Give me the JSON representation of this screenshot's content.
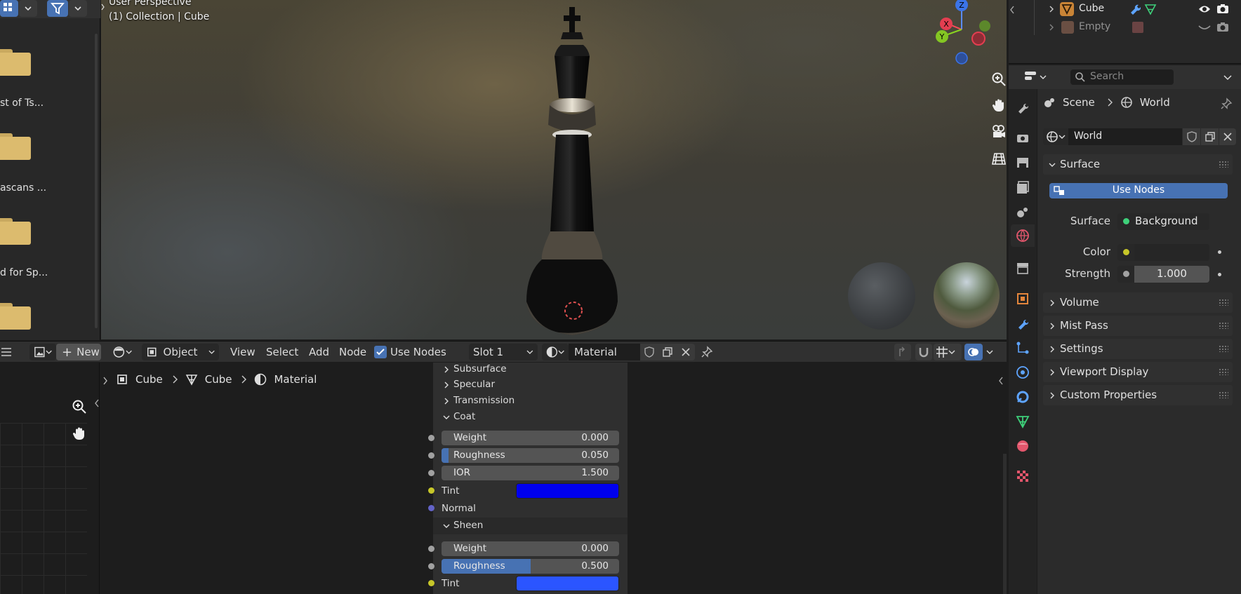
{
  "file_browser": {
    "items": [
      {
        "label": "st of Ts..."
      },
      {
        "label": "ascans ..."
      },
      {
        "label": "d for Sp..."
      },
      {
        "label": ""
      }
    ]
  },
  "viewport": {
    "line1": "User Perspective",
    "line2": "(1) Collection | Cube",
    "gizmo": {
      "z": "Z",
      "x": "X",
      "y": "Y"
    }
  },
  "node_editor_header": {
    "new_label": "New",
    "mode_label": "Object",
    "menus": [
      "View",
      "Select",
      "Add",
      "Node"
    ],
    "use_nodes_label": "Use Nodes",
    "use_nodes_checked": true,
    "slot_label": "Slot 1",
    "material_name": "Material"
  },
  "breadcrumb": [
    "Cube",
    "Cube",
    "Material"
  ],
  "node": {
    "collapsed": [
      "Subsurface",
      "Specular",
      "Transmission"
    ],
    "coat": {
      "title": "Coat",
      "weight": {
        "label": "Weight",
        "value": "0.000",
        "fraction": 0
      },
      "roughness": {
        "label": "Roughness",
        "value": "0.050",
        "fraction": 0.05
      },
      "ior": {
        "label": "IOR",
        "value": "1.500",
        "fraction": 0
      },
      "tint_label": "Tint",
      "tint_color": "#0000ee",
      "normal_label": "Normal"
    },
    "sheen": {
      "title": "Sheen",
      "weight": {
        "label": "Weight",
        "value": "0.000",
        "fraction": 0
      },
      "roughness": {
        "label": "Roughness",
        "value": "0.500",
        "fraction": 0.5
      },
      "tint_label": "Tint",
      "tint_color": "#2b55ff"
    }
  },
  "outliner": {
    "items": [
      {
        "label": "Cube"
      },
      {
        "label": "Empty"
      }
    ]
  },
  "properties": {
    "search_placeholder": "Search",
    "breadcrumb_scene": "Scene",
    "breadcrumb_world": "World",
    "world_name": "World",
    "surface_panel": "Surface",
    "use_nodes_button": "Use Nodes",
    "surface_label": "Surface",
    "surface_value": "Background",
    "color_label": "Color",
    "strength_label": "Strength",
    "strength_value": "1.000",
    "panels": [
      "Volume",
      "Mist Pass",
      "Settings",
      "Viewport Display",
      "Custom Properties"
    ]
  },
  "colors": {
    "accent": "#4772b3",
    "socket_yellow": "#c7c729",
    "socket_gray": "#a1a1a1",
    "socket_purple": "#6363c7"
  }
}
